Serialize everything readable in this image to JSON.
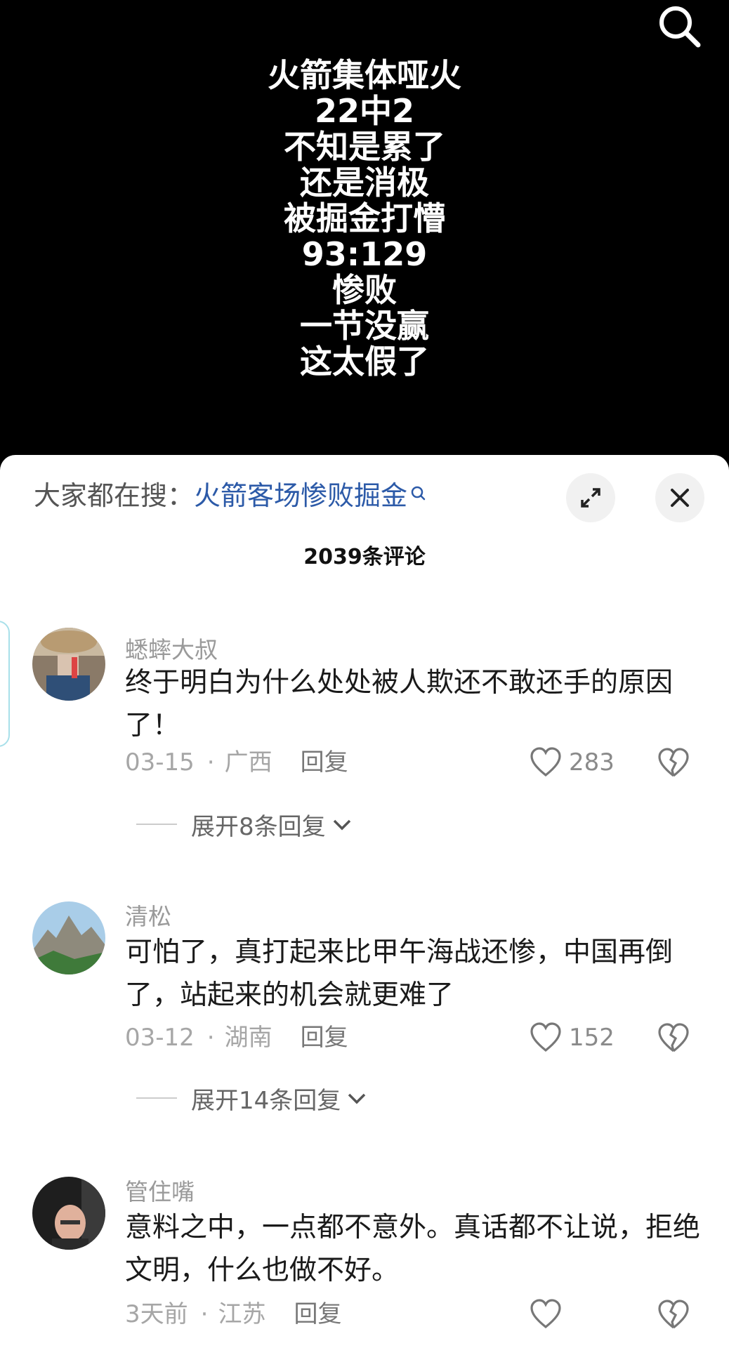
{
  "video": {
    "overlay_lines": [
      "火箭集体哑火",
      "22中2",
      "不知是累了",
      "还是消极",
      "被掘金打懵",
      "93:129",
      "惨败",
      "一节没赢",
      "这太假了"
    ],
    "search_icon": "search-icon"
  },
  "sheet": {
    "trending_prefix": "大家都在搜：",
    "trending_keyword": "火箭客场惨败掘金",
    "comment_count": "2039条评论"
  },
  "comments": [
    {
      "username": "蟋蟀大叔",
      "text": "终于明白为什么处处被人欺还不敢还手的原因了！",
      "date": "03-15",
      "location": "广西",
      "reply_label": "回复",
      "likes": "283",
      "expand_label": "展开8条回复"
    },
    {
      "username": "清松",
      "text": "可怕了，真打起来比甲午海战还惨，中国再倒了，站起来的机会就更难了",
      "date": "03-12",
      "location": "湖南",
      "reply_label": "回复",
      "likes": "152",
      "expand_label": "展开14条回复"
    },
    {
      "username": "管住嘴",
      "text": "意料之中，一点都不意外。真话都不让说，拒绝文明，什么也做不好。",
      "date": "3天前",
      "location": "江苏",
      "reply_label": "回复",
      "likes": ""
    }
  ],
  "colors": {
    "keyword_blue": "#2c5aa8",
    "meta_grey": "#a6a6a6",
    "side_tab": "#a8e0ea"
  }
}
